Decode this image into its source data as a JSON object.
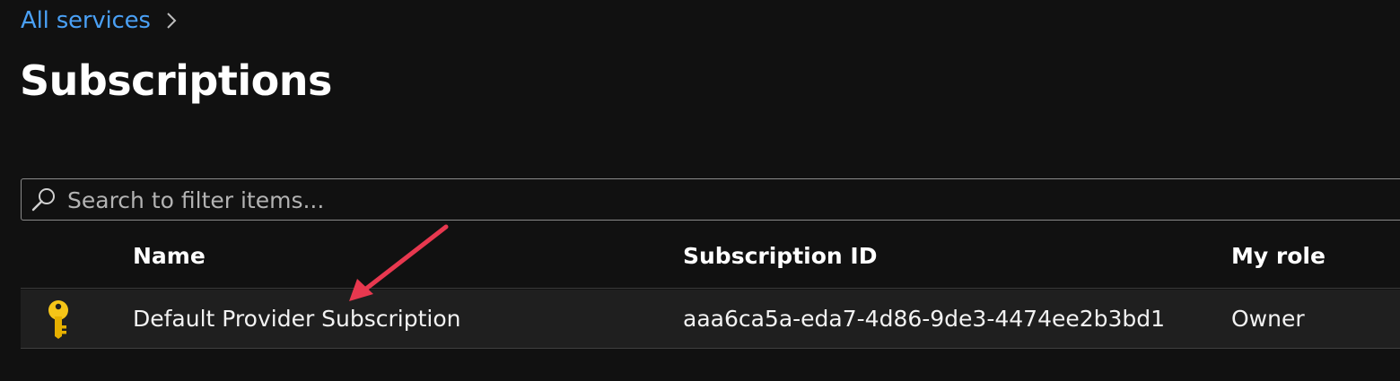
{
  "breadcrumb": {
    "link_label": "All services"
  },
  "page": {
    "title": "Subscriptions"
  },
  "search": {
    "placeholder": "Search to filter items...",
    "value": ""
  },
  "table": {
    "columns": [
      "Name",
      "Subscription ID",
      "My role"
    ],
    "rows": [
      {
        "icon": "key-icon",
        "name": "Default Provider Subscription",
        "subscription_id": "aaa6ca5a-eda7-4d86-9de3-4474ee2b3bd1",
        "role": "Owner"
      }
    ]
  },
  "colors": {
    "background": "#111111",
    "link": "#4aa0f5",
    "row_background": "#1f1f1f",
    "key_icon": "#f5c518",
    "annotation_arrow": "#e8384f"
  },
  "icons": {
    "breadcrumb_separator": "chevron-right-icon",
    "search": "search-icon",
    "row": "key-icon",
    "annotation": "arrow-icon"
  }
}
